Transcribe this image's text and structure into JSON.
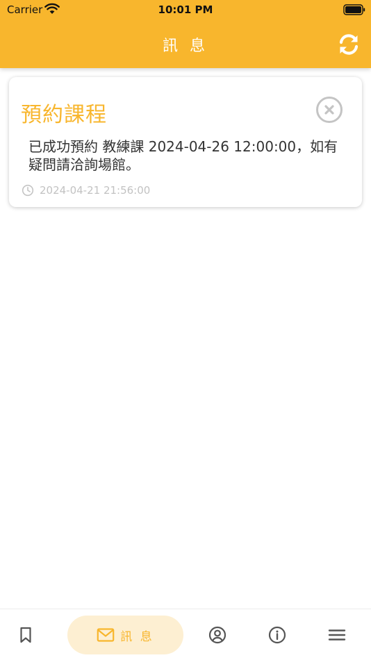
{
  "status_bar": {
    "carrier": "Carrier",
    "time": "10:01 PM"
  },
  "nav": {
    "title": "訊 息",
    "refresh_icon": "refresh-icon"
  },
  "messages": [
    {
      "title": "預約課程",
      "body": "已成功預約 教練課 2024-04-26 12:00:00，如有疑問請洽詢場館。",
      "timestamp": "2024-04-21 21:56:00"
    }
  ],
  "tabbar": {
    "items": [
      {
        "icon": "bookmark-icon",
        "label": ""
      },
      {
        "icon": "mail-icon",
        "label": "訊 息",
        "active": true
      },
      {
        "icon": "user-circle-icon",
        "label": ""
      },
      {
        "icon": "info-icon",
        "label": ""
      },
      {
        "icon": "menu-icon",
        "label": ""
      }
    ]
  },
  "colors": {
    "accent": "#f8b62d",
    "active_tab_bg": "#fdefd2",
    "body_text": "#333333",
    "muted_text": "#c2c2c2",
    "icon_gray": "#555555"
  }
}
